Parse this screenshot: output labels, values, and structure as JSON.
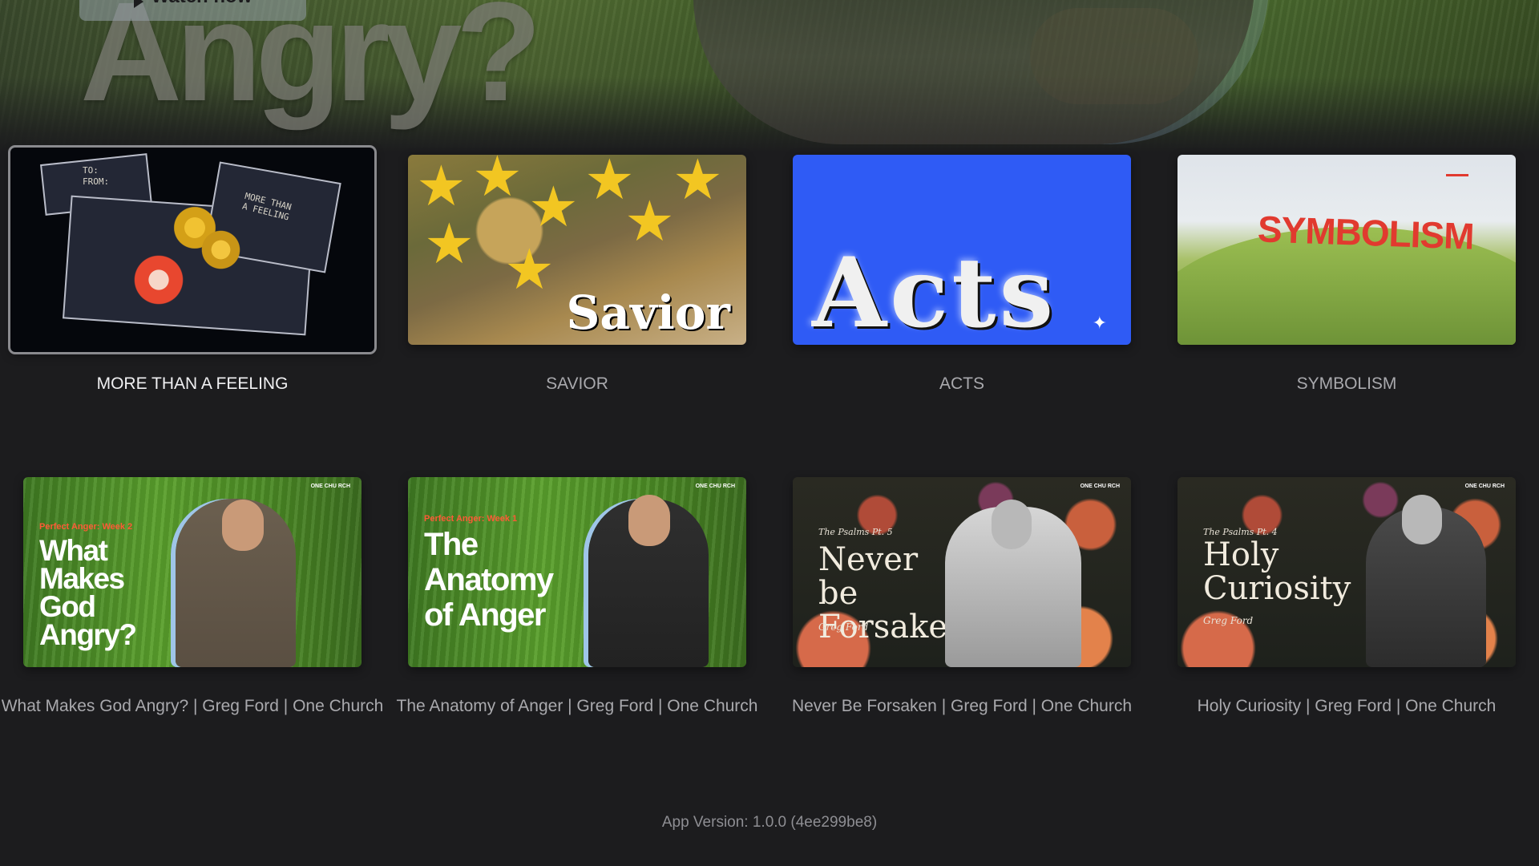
{
  "hero": {
    "title": "Angry?",
    "watch_label": "Watch now"
  },
  "row1": [
    {
      "title": "MORE THAN A FEELING",
      "focused": true,
      "art": {
        "to": "TO:",
        "from": "FROM:",
        "tag": "MORE THAN A FEELING"
      }
    },
    {
      "title": "SAVIOR",
      "art": {
        "word": "Savior"
      }
    },
    {
      "title": "ACTS",
      "art": {
        "word": "Acts"
      }
    },
    {
      "title": "SYMBOLISM",
      "art": {
        "word": "SYMBOLISM"
      }
    }
  ],
  "row2": [
    {
      "title": "What Makes God Angry? | Greg Ford | One Church",
      "art": {
        "series": "Perfect Anger: Week 2",
        "title_lines": "What Makes God Angry?"
      }
    },
    {
      "title": "The Anatomy of Anger | Greg Ford | One Church",
      "art": {
        "series": "Perfect Anger: Week 1",
        "title_lines": "The Anatomy of Anger"
      }
    },
    {
      "title": "Never Be Forsaken | Greg Ford | One Church",
      "art": {
        "series": "The Psalms Pt. 5",
        "title_lines": "Never be Forsaken",
        "by": "Greg Ford"
      }
    },
    {
      "title": "Holy Curiosity | Greg Ford | One Church",
      "art": {
        "series": "The Psalms Pt. 4",
        "title_lines": "Holy Curiosity",
        "by": "Greg Ford"
      }
    }
  ],
  "logo": "ONE CHU RCH",
  "footer": {
    "version": "App Version: 1.0.0 (4ee299be8)"
  }
}
